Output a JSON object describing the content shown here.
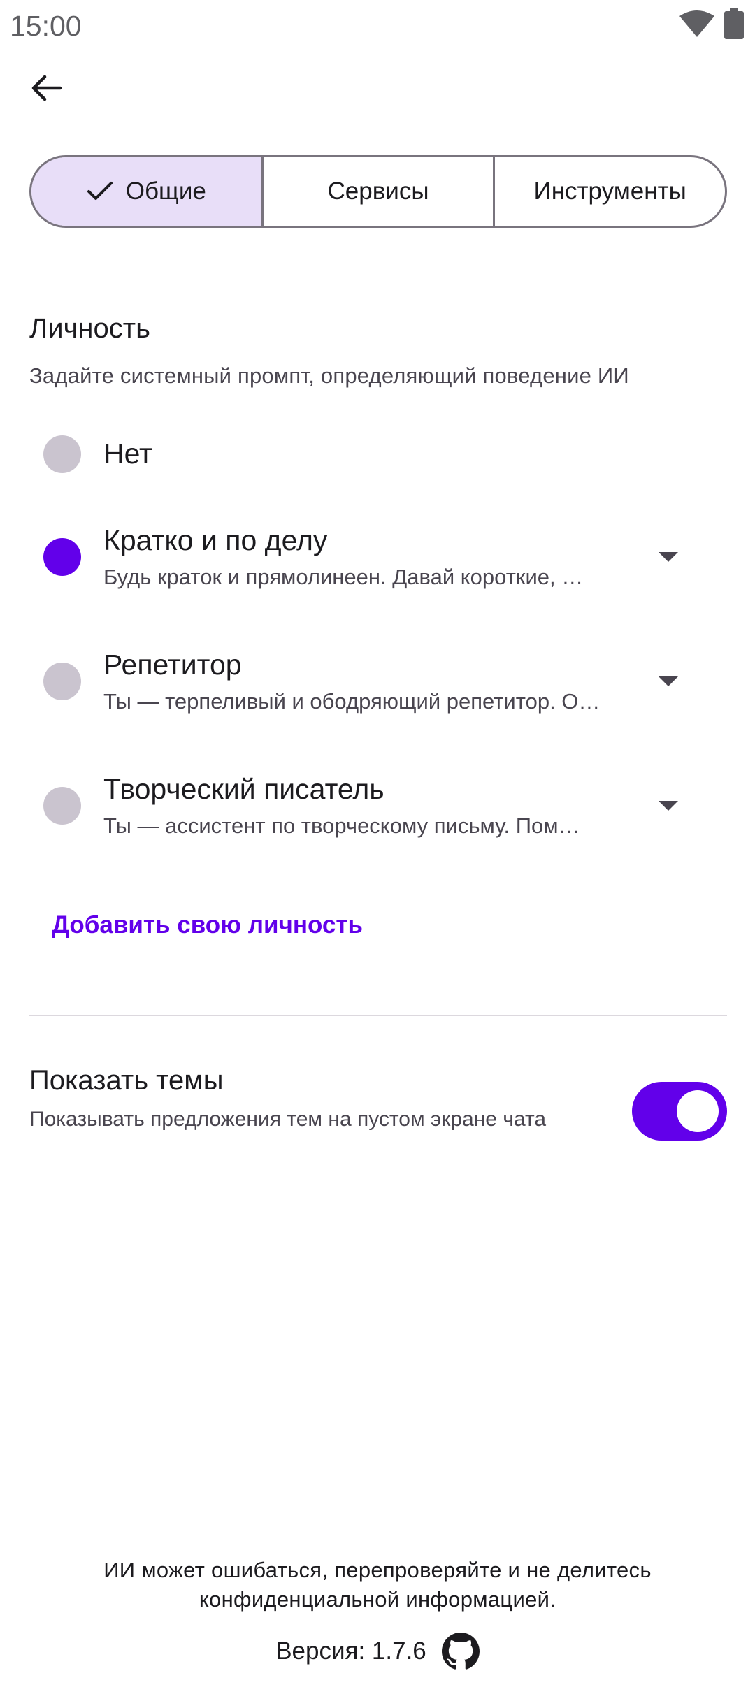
{
  "status_bar": {
    "time": "15:00",
    "icons": [
      "wifi-icon",
      "battery-icon"
    ]
  },
  "toolbar": {
    "back_icon": "arrow-back-icon"
  },
  "tabs": [
    {
      "label": "Общие",
      "selected": true
    },
    {
      "label": "Сервисы",
      "selected": false
    },
    {
      "label": "Инструменты",
      "selected": false
    }
  ],
  "personality": {
    "title": "Личность",
    "subtitle": "Задайте системный промпт, определяющий поведение ИИ",
    "options": [
      {
        "title": "Нет",
        "desc": "",
        "selected": false
      },
      {
        "title": "Кратко и по делу",
        "desc": "Будь краток и прямолинеен. Давай короткие, …",
        "selected": true
      },
      {
        "title": "Репетитор",
        "desc": "Ты — терпеливый и ободряющий репетитор. О…",
        "selected": false
      },
      {
        "title": "Творческий писатель",
        "desc": "Ты — ассистент по творческому письму. Пом…",
        "selected": false
      }
    ],
    "add_label": "Добавить свою личность"
  },
  "topics": {
    "title": "Показать темы",
    "subtitle": "Показывать предложения тем на пустом экране чата",
    "enabled": true
  },
  "footer": {
    "disclaimer": "ИИ может ошибаться, перепроверяйте и не делитесь конфиденциальной информацией.",
    "version": "Версия: 1.7.6",
    "github_icon": "github-icon"
  },
  "colors": {
    "accent": "#6200ea",
    "tab_selected_bg": "#e8def8",
    "radio_off": "#cac4cf"
  }
}
